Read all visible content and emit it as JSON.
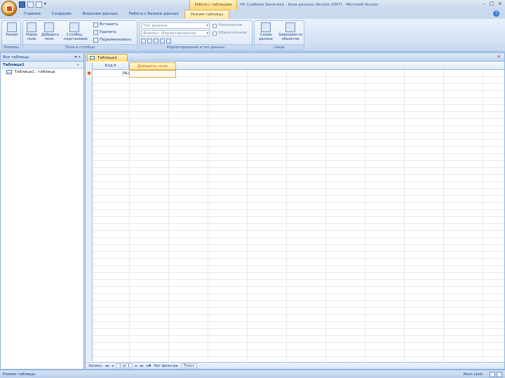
{
  "window": {
    "title": "Н5 Сумбаев Занятие1 : база данных (Access 2007) - Microsoft Access",
    "context_tab_header": "Работа с таблицами",
    "controls": [
      "–",
      "□",
      "×"
    ]
  },
  "ribbon_tabs": [
    {
      "label": "Главная",
      "active": false
    },
    {
      "label": "Создание",
      "active": false
    },
    {
      "label": "Внешние данные",
      "active": false
    },
    {
      "label": "Работа с базами данных",
      "active": false
    },
    {
      "label": "Режим таблицы",
      "active": true
    }
  ],
  "ribbon": {
    "groups": {
      "views": "Режимы",
      "fields_columns": "Поля и столбцы",
      "formatting": "Форматирование и тип данных",
      "relationships": "Связи"
    },
    "views_button": "Режим",
    "new_field": "Новое поле",
    "add_field": "Добавить поля",
    "lookup_column": "Столбец подстановок",
    "insert": "Вставить",
    "delete": "Удалить",
    "rename": "Переименовать",
    "data_type_label": "Тип данных:",
    "format_label": "Формат:",
    "format_value": "Форматирование",
    "unique": "Уникальное",
    "required": "Обязательное",
    "relationships_btn": "Схема данных",
    "dependencies_btn": "Зависимости объектов"
  },
  "nav": {
    "header": "Все таблицы",
    "group": "Таблица1",
    "item": "Таблица1 : таблица"
  },
  "doc": {
    "tab": "Таблица1",
    "columns": {
      "id": "Код",
      "add_field": "Добавить поле"
    },
    "new_row_value": "(№)",
    "record_label": "Запись:",
    "record_pos": "1 из 1",
    "filter": "Нет фильтра",
    "search": "Поиск"
  },
  "status": {
    "left": "Режим таблицы",
    "right": "Num Lock"
  }
}
